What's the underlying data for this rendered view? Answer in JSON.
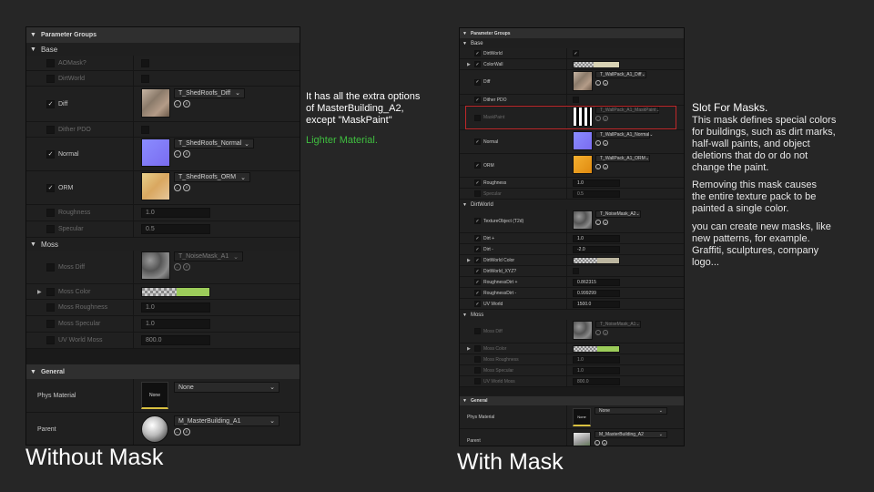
{
  "left": {
    "header": "Parameter Groups",
    "base": {
      "title": "Base",
      "rows": [
        {
          "label": "AOMask?",
          "checked": false
        },
        {
          "label": "DirtWorld",
          "checked": false
        },
        {
          "label": "Diff",
          "checked": true,
          "texture": "T_ShedRoofs_Diff"
        },
        {
          "label": "Dither PDO",
          "checked": false
        },
        {
          "label": "Normal",
          "checked": true,
          "texture": "T_ShedRoofs_Normal"
        },
        {
          "label": "ORM",
          "checked": true,
          "texture": "T_ShedRoofs_ORM"
        },
        {
          "label": "Roughness",
          "checked": false,
          "value": "1.0"
        },
        {
          "label": "Specular",
          "checked": false,
          "value": "0.5"
        }
      ]
    },
    "moss": {
      "title": "Moss",
      "rows": [
        {
          "label": "Moss Diff",
          "texture": "T_NoiseMask_A1"
        },
        {
          "label": "Moss Color"
        },
        {
          "label": "Moss Roughness",
          "value": "1.0"
        },
        {
          "label": "Moss Specular",
          "value": "1.0"
        },
        {
          "label": "UV World Moss",
          "value": "800.0"
        }
      ]
    },
    "general": {
      "title": "General",
      "phys_label": "Phys Material",
      "phys_thumb": "None",
      "phys_value": "None",
      "parent_label": "Parent",
      "parent_value": "M_MasterBuilding_A1"
    }
  },
  "right": {
    "header": "Parameter Groups",
    "base": {
      "title": "Base",
      "rows": [
        {
          "label": "DirtWorld"
        },
        {
          "label": "ColorWall"
        },
        {
          "label": "Diff",
          "texture": "T_WallPack_A1_Diff"
        },
        {
          "label": "Dither PDO"
        },
        {
          "label": "MaskPaint",
          "texture": "T_WallPack_A1_MaskPaint"
        },
        {
          "label": "Normal",
          "texture": "T_WallPack_A1_Normal"
        },
        {
          "label": "ORM",
          "texture": "T_WallPack_A1_ORM"
        },
        {
          "label": "Roughness",
          "value": "1.0"
        },
        {
          "label": "Specular",
          "value": "0.5"
        }
      ]
    },
    "dirt": {
      "title": "DirtWorld",
      "rows": [
        {
          "label": "TextureObject (T2d)",
          "texture": "T_NoiseMask_A2"
        },
        {
          "label": "Dirt +",
          "value": "1.0"
        },
        {
          "label": "Dirt -",
          "value": "-2.0"
        },
        {
          "label": "DirtWorld Color"
        },
        {
          "label": "DirtWorld_XYZ?"
        },
        {
          "label": "RoughnessDirt +",
          "value": "0.862315"
        },
        {
          "label": "RoughnessDirt -",
          "value": "0.999299"
        },
        {
          "label": "UV World",
          "value": "1500.0"
        }
      ]
    },
    "moss": {
      "title": "Moss",
      "rows": [
        {
          "label": "Moss Diff",
          "texture": "T_NoiseMask_A1"
        },
        {
          "label": "Moss Color"
        },
        {
          "label": "Moss Roughness",
          "value": "1.0"
        },
        {
          "label": "Moss Specular",
          "value": "1.0"
        },
        {
          "label": "UV World Moss",
          "value": "800.0"
        }
      ]
    },
    "general": {
      "title": "General",
      "phys_label": "Phys Material",
      "phys_thumb": "None",
      "phys_value": "None",
      "parent_label": "Parent",
      "parent_value": "M_MasterBuilding_A2"
    }
  },
  "annotations": {
    "middle_note": "It has all the extra options of MasterBuilding_A2, except \"MaskPaint\"",
    "lighter": "Lighter Material.",
    "slot_title": "Slot For Masks.",
    "slot_p1": "This mask defines special colors for buildings, such as dirt marks, half-wall paints, and object deletions that do or do not change the paint.",
    "slot_p2": "Removing this mask causes the entire texture pack to be painted a single color.",
    "slot_p3": "you can create new masks, like new patterns, for example. Graffiti, sculptures, company logo..."
  },
  "captions": {
    "left": "Without Mask",
    "right": "With Mask"
  },
  "colors": {
    "highlight_border": "#c0282a",
    "lighter_text": "#3fbf3f",
    "moss_green": "#9ccc5a",
    "dirt_color": "#bcb6a0",
    "colorwall": "#d8d2b4"
  }
}
